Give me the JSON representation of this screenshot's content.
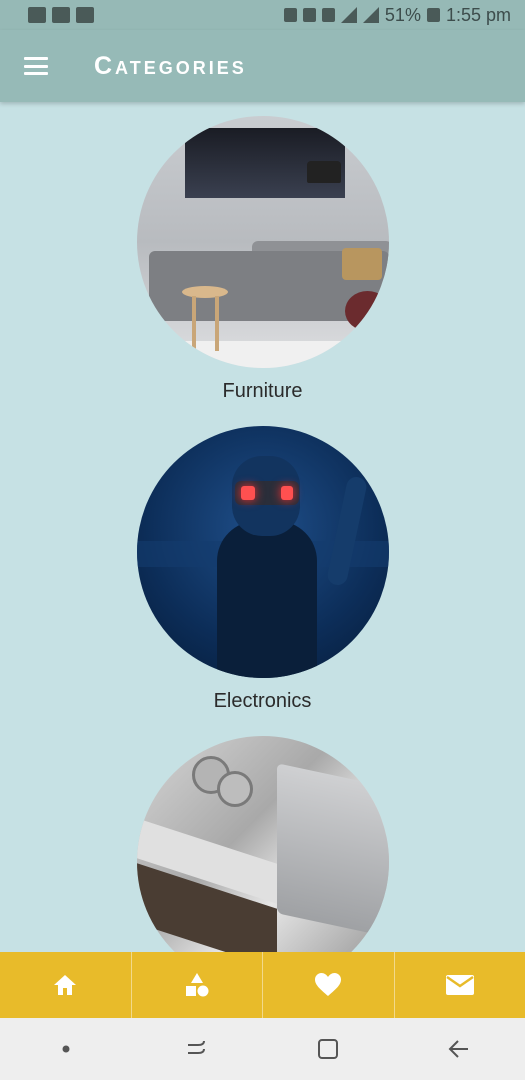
{
  "status_bar": {
    "battery": "51%",
    "time": "1:55 pm"
  },
  "app_bar": {
    "title": "Categories",
    "menu_icon": "hamburger-menu-icon"
  },
  "categories": [
    {
      "label": "Furniture"
    },
    {
      "label": "Electronics"
    },
    {
      "label": ""
    }
  ],
  "bottom_nav": {
    "items": [
      {
        "icon": "home-icon"
      },
      {
        "icon": "shapes-icon"
      },
      {
        "icon": "heart-icon"
      },
      {
        "icon": "mail-icon"
      }
    ]
  },
  "colors": {
    "background": "#c6e1e4",
    "app_bar": "#96bab7",
    "bottom_nav": "#e8bb2a"
  }
}
